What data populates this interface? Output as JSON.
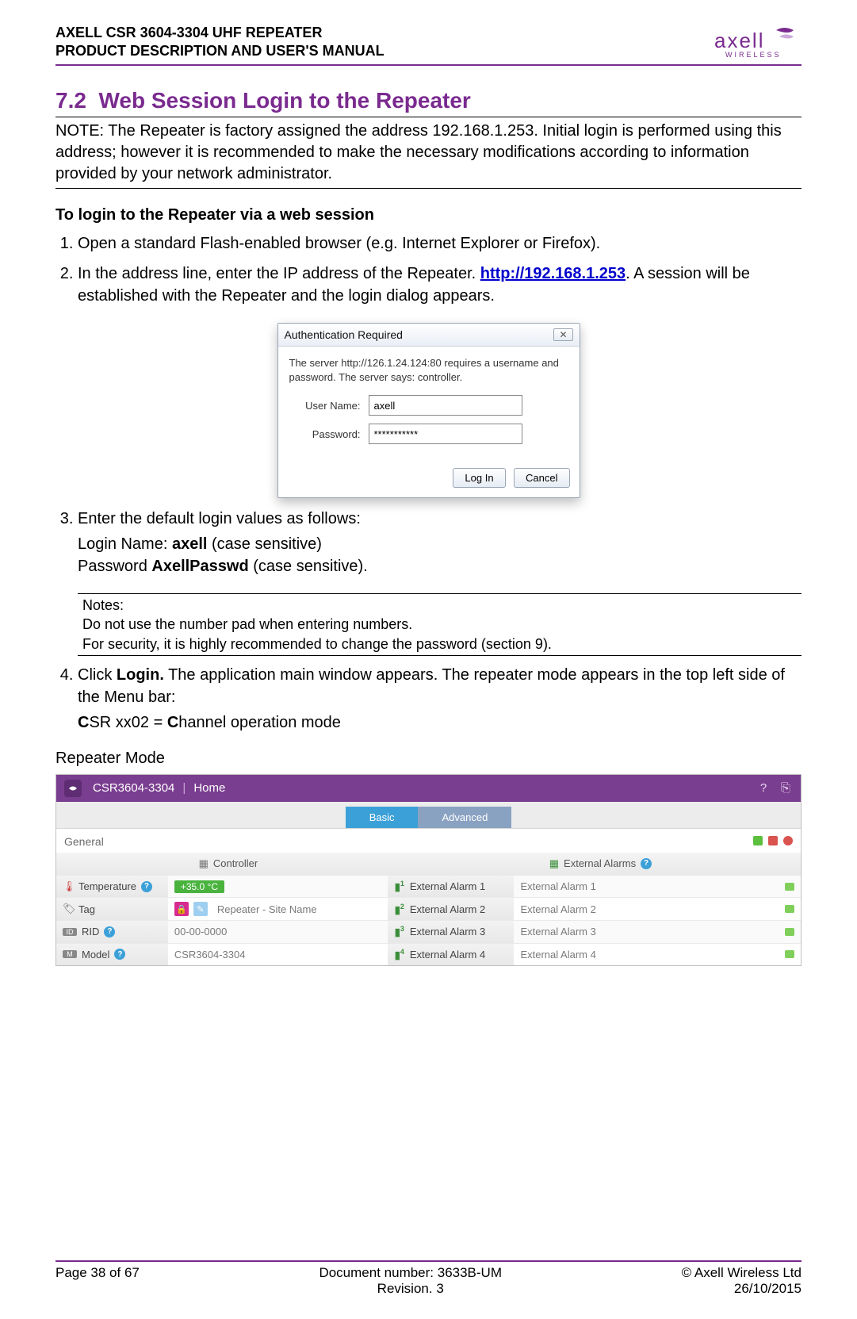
{
  "header": {
    "line1": "AXELL CSR 3604-3304 UHF REPEATER",
    "line2": "PRODUCT DESCRIPTION AND USER'S MANUAL",
    "logo_brand": "axell",
    "logo_sub": "WIRELESS"
  },
  "section": {
    "number": "7.2",
    "title": "Web Session Login to the Repeater"
  },
  "note": "NOTE: The Repeater is factory assigned the address 192.168.1.253. Initial login is performed using this address; however it is recommended to make the necessary modifications according to information provided by your network administrator.",
  "subheading": "To login to the Repeater via a web session",
  "steps": {
    "s1": "Open a standard Flash-enabled browser (e.g. Internet Explorer or Firefox).",
    "s2_pre": "In the address line, enter the IP address of the Repeater. ",
    "s2_link": "http://192.168.1.253",
    "s2_post": ". A session will be established with the Repeater and the login dialog appears.",
    "s3": "Enter the default login values as follows:",
    "s3_login_pre": "Login Name: ",
    "s3_login_val": "axell",
    "s3_login_post": " (case sensitive)",
    "s3_pass_pre": "Password ",
    "s3_pass_val": "AxellPasswd",
    "s3_pass_post": " (case sensitive).",
    "notes_title": "Notes:",
    "notes_l1": "Do not use the number pad when entering numbers.",
    "notes_l2": "For security, it is highly recommended to change the password (section 9).",
    "s4_pre": "Click ",
    "s4_bold": "Login.",
    "s4_post": " The application main window appears. The repeater mode appears in the top left side of the Menu bar:",
    "s4_mode_b1": "C",
    "s4_mode_t1": "SR xx02 = ",
    "s4_mode_b2": "C",
    "s4_mode_t2": "hannel operation mode"
  },
  "dialog": {
    "title": "Authentication Required",
    "close": "✕",
    "message": "The server http://126.1.24.124:80 requires a username and password. The server says: controller.",
    "user_label": "User Name:",
    "user_value": "axell",
    "pass_label": "Password:",
    "pass_value": "***********",
    "btn_login": "Log In",
    "btn_cancel": "Cancel"
  },
  "mode_label": "Repeater Mode",
  "app": {
    "product": "CSR3604-3304",
    "home": "Home",
    "tab_basic": "Basic",
    "tab_adv": "Advanced",
    "panel": "General",
    "col_controller": "Controller",
    "col_extalarms": "External Alarms",
    "rows": {
      "temp_label": "Temperature",
      "temp_value": "+35.0 °C",
      "tag_label": "Tag",
      "tag_value": "Repeater - Site Name",
      "rid_label": "RID",
      "rid_value": "00-00-0000",
      "model_label": "Model",
      "model_value": "CSR3604-3304",
      "ea1_label": "External Alarm 1",
      "ea1_value": "External Alarm 1",
      "ea2_label": "External Alarm 2",
      "ea2_value": "External Alarm 2",
      "ea3_label": "External Alarm 3",
      "ea3_value": "External Alarm 3",
      "ea4_label": "External Alarm 4",
      "ea4_value": "External Alarm 4"
    }
  },
  "footer": {
    "page": "Page 38 of 67",
    "docnum": "Document number: 3633B-UM",
    "rev": "Revision. 3",
    "copyright": "© Axell Wireless Ltd",
    "date": "26/10/2015"
  }
}
